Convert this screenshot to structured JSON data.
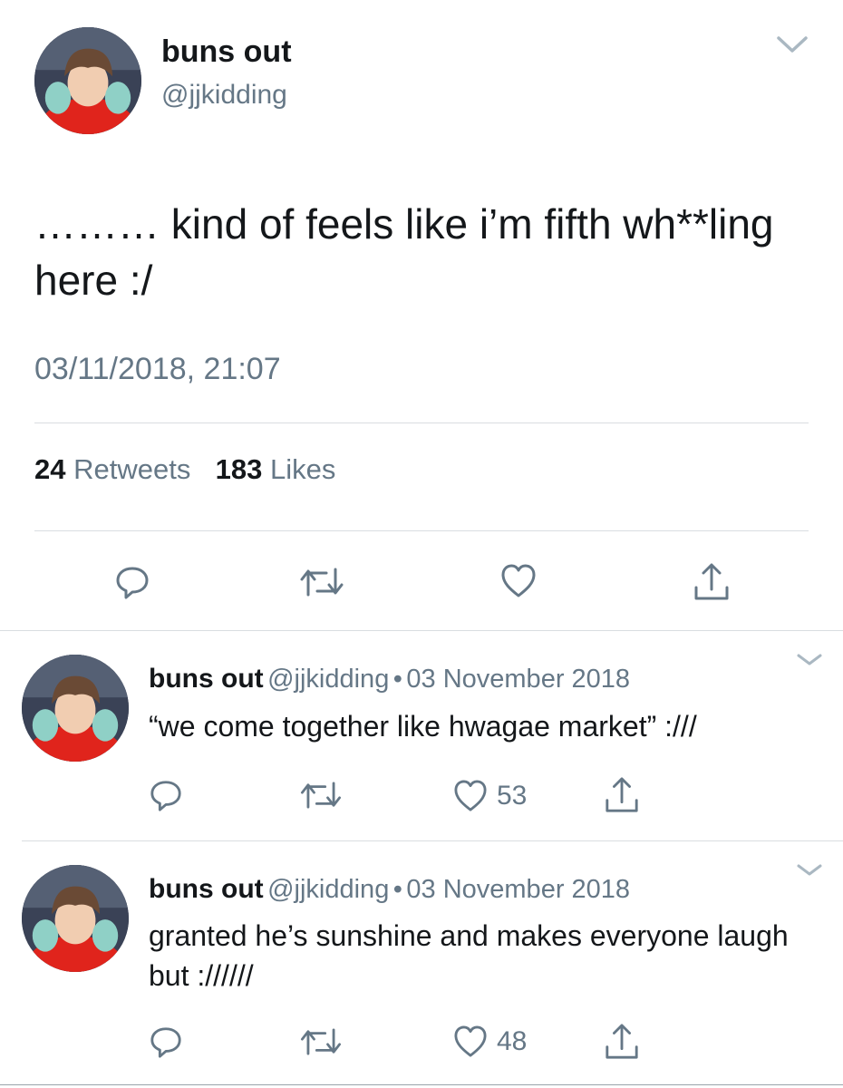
{
  "main_tweet": {
    "display_name": "buns out",
    "handle": "@jjkidding",
    "text": "……… kind of feels like i’m fifth wh**ling here :/",
    "timestamp": "03/11/2018, 21:07",
    "retweets_count": "24",
    "retweets_label": "Retweets",
    "likes_count": "183",
    "likes_label": "Likes"
  },
  "replies": [
    {
      "display_name": "buns out",
      "handle": "@jjkidding",
      "separator": "•",
      "date": "03 November 2018",
      "text": "“we come together like hwagae market” :///",
      "likes": "53"
    },
    {
      "display_name": "buns out",
      "handle": "@jjkidding",
      "separator": "•",
      "date": "03 November 2018",
      "text": "granted he’s sunshine and makes everyone laugh but ://////",
      "likes": "48"
    }
  ],
  "icons": {
    "reply": "reply-icon",
    "retweet": "retweet-icon",
    "like": "heart-icon",
    "share": "share-icon",
    "menu": "chevron-down-icon"
  },
  "colors": {
    "primary_text": "#14171a",
    "secondary_text": "#657786",
    "divider": "#d9dde1",
    "background": "#ffffff"
  }
}
